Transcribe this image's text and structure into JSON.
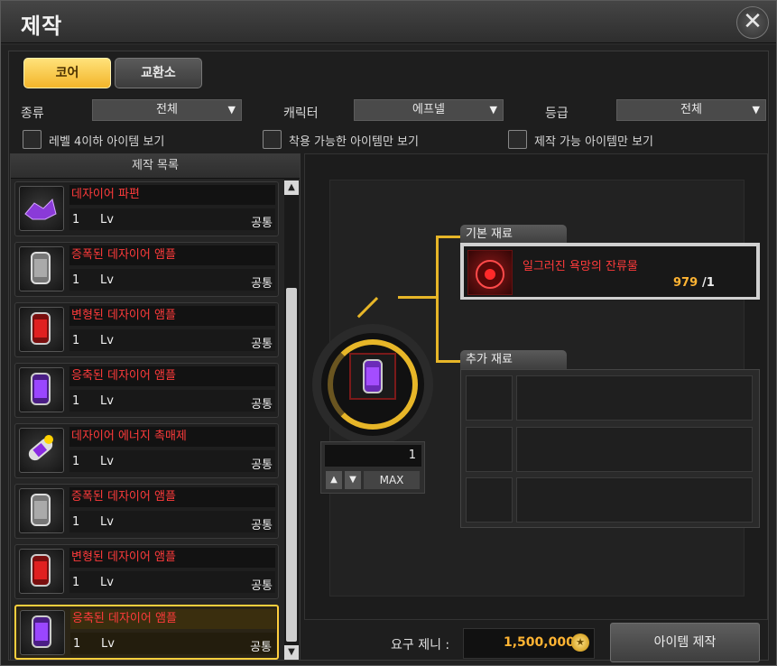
{
  "window": {
    "title": "제작",
    "close_symbol": "✕"
  },
  "tabs": [
    {
      "label": "코어",
      "active": true
    },
    {
      "label": "교환소",
      "active": false
    }
  ],
  "filters": {
    "type_label": "종류",
    "type_value": "전체",
    "character_label": "캐릭터",
    "character_value": "에프넬",
    "grade_label": "등급",
    "grade_value": "전체",
    "dropdown_arrow": "▼"
  },
  "checkboxes": [
    {
      "label": "레벨 4이하 아이템 보기",
      "checked": false
    },
    {
      "label": "착용 가능한 아이템만 보기",
      "checked": false
    },
    {
      "label": "제작 가능 아이템만 보기",
      "checked": false
    }
  ],
  "craft_list": {
    "header": "제작 목록",
    "items": [
      {
        "name": "데자이어 파편",
        "level": "1",
        "lv_label": "Lv",
        "class": "공통",
        "icon": "purple-shard-icon",
        "selected": false
      },
      {
        "name": "증폭된 데자이어 앰플",
        "level": "1",
        "lv_label": "Lv",
        "class": "공통",
        "icon": "silver-ampoule-icon",
        "selected": false
      },
      {
        "name": "변형된 데자이어 앰플",
        "level": "1",
        "lv_label": "Lv",
        "class": "공통",
        "icon": "red-ampoule-icon",
        "selected": false
      },
      {
        "name": "응축된 데자이어 앰플",
        "level": "1",
        "lv_label": "Lv",
        "class": "공통",
        "icon": "purple-ampoule-icon",
        "selected": false
      },
      {
        "name": "데자이어 에너지 촉매제",
        "level": "1",
        "lv_label": "Lv",
        "class": "공통",
        "icon": "catalyst-icon",
        "selected": false
      },
      {
        "name": "증폭된 데자이어 앰플",
        "level": "1",
        "lv_label": "Lv",
        "class": "공통",
        "icon": "silver-ampoule-icon",
        "selected": false
      },
      {
        "name": "변형된 데자이어 앰플",
        "level": "1",
        "lv_label": "Lv",
        "class": "공통",
        "icon": "red-ampoule-icon",
        "selected": false
      },
      {
        "name": "응축된 데자이어 앰플",
        "level": "1",
        "lv_label": "Lv",
        "class": "공통",
        "icon": "purple-ampoule-icon",
        "selected": true
      }
    ]
  },
  "scroll": {
    "up": "▲",
    "down": "▼"
  },
  "crafting": {
    "quantity": "1",
    "up": "▲",
    "down": "▼",
    "max_label": "MAX",
    "basic_materials_label": "기본 재료",
    "basic_material": {
      "name": "일그러진 욕망의 잔류물",
      "have": "979",
      "need": "/1"
    },
    "extra_materials_label": "추가 재료"
  },
  "footer": {
    "zeny_label": "요구 제니 :",
    "zeny_value": "1,500,000",
    "coin_symbol": "★",
    "craft_button": "아이템 제작"
  },
  "colors": {
    "accent_gold": "#e7b628",
    "item_name_red": "#ff3b3b",
    "zeny_orange": "#ffb433"
  }
}
